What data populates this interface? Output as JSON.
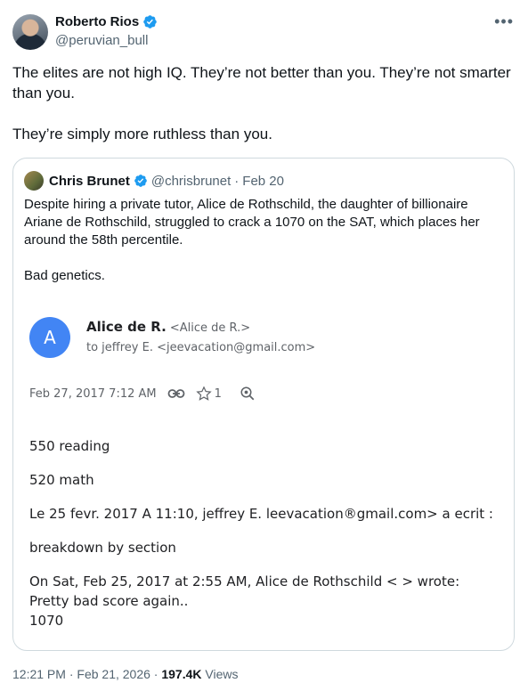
{
  "author": {
    "name": "Roberto Rios",
    "handle": "@peruvian_bull",
    "verified_color": "#1d9bf0"
  },
  "more_icon": "•••",
  "tweet": {
    "paragraph1": "The elites are not high IQ. They’re not better than you. They’re not smarter than you.",
    "paragraph2": "They’re simply more ruthless than you."
  },
  "quote": {
    "name": "Chris Brunet",
    "handle": "@chrisbrunet",
    "separator": "·",
    "date": "Feb 20",
    "paragraph1": "Despite hiring a private tutor, Alice de Rothschild, the daughter of billionaire Ariane de Rothschild, struggled to crack a 1070 on the SAT, which places her around the 58th percentile.",
    "paragraph2": "Bad genetics."
  },
  "email": {
    "avatar_letter": "A",
    "avatar_color": "#4285f4",
    "sender_name": "Alice de R.",
    "sender_addr": "<Alice de R.>",
    "to_line": "to jeffrey E. <jeevacation@gmail.com>",
    "timestamp": "Feb 27, 2017 7:12 AM",
    "link_icon": "link-icon",
    "star_count": "1",
    "body": [
      "550 reading",
      "520 math",
      "Le 25 fevr. 2017 A 11:10, jeffrey E. leevacation®gmail.com> a ecrit :",
      "breakdown by section",
      "On Sat, Feb 25, 2017 at 2:55 AM, Alice de Rothschild < > wrote:",
      "Pretty bad score again..",
      "1070"
    ]
  },
  "footer": {
    "time": "12:21 PM",
    "dot1": "·",
    "date": "Feb 21, 2026",
    "dot2": "·",
    "views_count": "197.4K",
    "views_label": "Views"
  }
}
